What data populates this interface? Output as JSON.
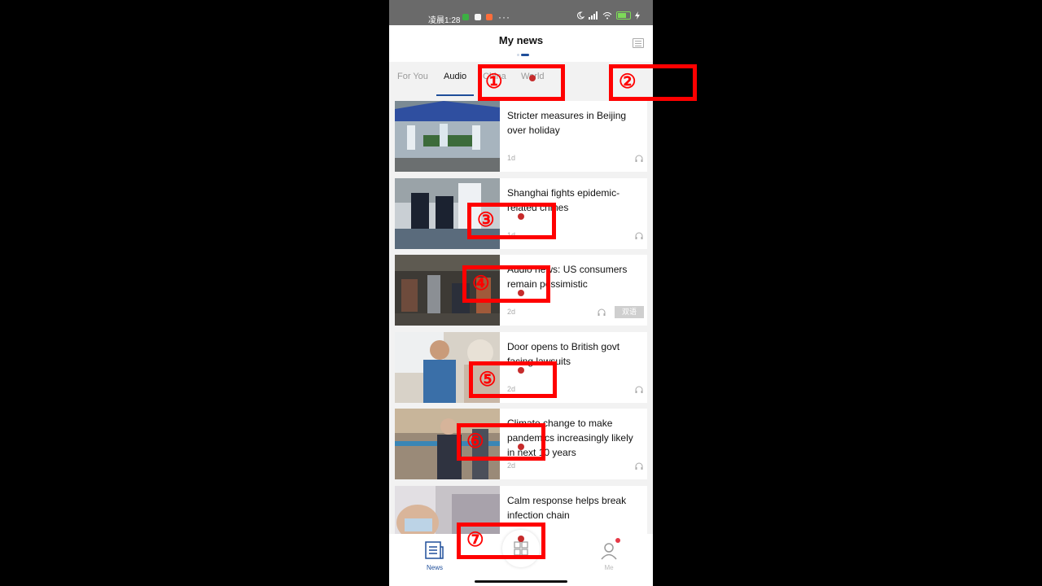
{
  "status_bar": {
    "time": "凌晨1:28",
    "more": "···",
    "battery": "73",
    "battery_level": 0.73
  },
  "header": {
    "title": "My news",
    "menu_icon": "list-icon"
  },
  "tabs": [
    {
      "label": "For You",
      "active": false
    },
    {
      "label": "Audio",
      "active": true
    },
    {
      "label": "China",
      "active": false
    },
    {
      "label": "World",
      "active": false
    }
  ],
  "articles": [
    {
      "title": "Stricter measures in Beijing over holiday",
      "age": "1d",
      "icon": "headphones-icon"
    },
    {
      "title": "Shanghai fights epidemic-related crimes",
      "age": "1d",
      "icon": "headphones-icon"
    },
    {
      "title": "Audio news: US consumers remain pessimistic",
      "age": "2d",
      "icon": "headphones-icon",
      "badge": "双语"
    },
    {
      "title": "Door opens to British govt facing lawsuits",
      "age": "2d",
      "icon": "headphones-icon"
    },
    {
      "title": "Climate change to make pandemics increasingly likely in next 10 years",
      "age": "2d",
      "icon": "headphones-icon"
    },
    {
      "title": "Calm response helps break infection chain",
      "age": "",
      "icon": "headphones-icon"
    }
  ],
  "bottom_nav": {
    "news": {
      "label": "News",
      "icon": "newspaper-icon"
    },
    "center": {
      "icon": "grid-icon"
    },
    "me": {
      "label": "Me",
      "icon": "person-icon"
    }
  },
  "annotations": [
    "①",
    "②",
    "③",
    "④",
    "⑤",
    "⑥",
    "⑦"
  ],
  "colors": {
    "accent": "#1f4e9a",
    "annotation": "#ff0000",
    "status_bar": "#6a6a6a",
    "background": "#f2f2f2"
  }
}
